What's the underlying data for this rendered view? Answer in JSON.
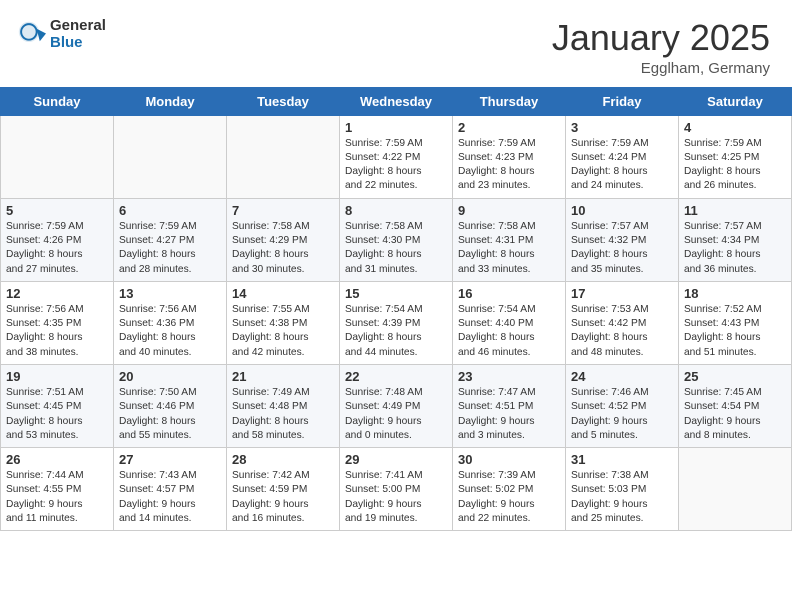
{
  "header": {
    "logo_general": "General",
    "logo_blue": "Blue",
    "month_title": "January 2025",
    "location": "Egglham, Germany"
  },
  "days_of_week": [
    "Sunday",
    "Monday",
    "Tuesday",
    "Wednesday",
    "Thursday",
    "Friday",
    "Saturday"
  ],
  "weeks": [
    [
      {
        "day": "",
        "info": ""
      },
      {
        "day": "",
        "info": ""
      },
      {
        "day": "",
        "info": ""
      },
      {
        "day": "1",
        "info": "Sunrise: 7:59 AM\nSunset: 4:22 PM\nDaylight: 8 hours\nand 22 minutes."
      },
      {
        "day": "2",
        "info": "Sunrise: 7:59 AM\nSunset: 4:23 PM\nDaylight: 8 hours\nand 23 minutes."
      },
      {
        "day": "3",
        "info": "Sunrise: 7:59 AM\nSunset: 4:24 PM\nDaylight: 8 hours\nand 24 minutes."
      },
      {
        "day": "4",
        "info": "Sunrise: 7:59 AM\nSunset: 4:25 PM\nDaylight: 8 hours\nand 26 minutes."
      }
    ],
    [
      {
        "day": "5",
        "info": "Sunrise: 7:59 AM\nSunset: 4:26 PM\nDaylight: 8 hours\nand 27 minutes."
      },
      {
        "day": "6",
        "info": "Sunrise: 7:59 AM\nSunset: 4:27 PM\nDaylight: 8 hours\nand 28 minutes."
      },
      {
        "day": "7",
        "info": "Sunrise: 7:58 AM\nSunset: 4:29 PM\nDaylight: 8 hours\nand 30 minutes."
      },
      {
        "day": "8",
        "info": "Sunrise: 7:58 AM\nSunset: 4:30 PM\nDaylight: 8 hours\nand 31 minutes."
      },
      {
        "day": "9",
        "info": "Sunrise: 7:58 AM\nSunset: 4:31 PM\nDaylight: 8 hours\nand 33 minutes."
      },
      {
        "day": "10",
        "info": "Sunrise: 7:57 AM\nSunset: 4:32 PM\nDaylight: 8 hours\nand 35 minutes."
      },
      {
        "day": "11",
        "info": "Sunrise: 7:57 AM\nSunset: 4:34 PM\nDaylight: 8 hours\nand 36 minutes."
      }
    ],
    [
      {
        "day": "12",
        "info": "Sunrise: 7:56 AM\nSunset: 4:35 PM\nDaylight: 8 hours\nand 38 minutes."
      },
      {
        "day": "13",
        "info": "Sunrise: 7:56 AM\nSunset: 4:36 PM\nDaylight: 8 hours\nand 40 minutes."
      },
      {
        "day": "14",
        "info": "Sunrise: 7:55 AM\nSunset: 4:38 PM\nDaylight: 8 hours\nand 42 minutes."
      },
      {
        "day": "15",
        "info": "Sunrise: 7:54 AM\nSunset: 4:39 PM\nDaylight: 8 hours\nand 44 minutes."
      },
      {
        "day": "16",
        "info": "Sunrise: 7:54 AM\nSunset: 4:40 PM\nDaylight: 8 hours\nand 46 minutes."
      },
      {
        "day": "17",
        "info": "Sunrise: 7:53 AM\nSunset: 4:42 PM\nDaylight: 8 hours\nand 48 minutes."
      },
      {
        "day": "18",
        "info": "Sunrise: 7:52 AM\nSunset: 4:43 PM\nDaylight: 8 hours\nand 51 minutes."
      }
    ],
    [
      {
        "day": "19",
        "info": "Sunrise: 7:51 AM\nSunset: 4:45 PM\nDaylight: 8 hours\nand 53 minutes."
      },
      {
        "day": "20",
        "info": "Sunrise: 7:50 AM\nSunset: 4:46 PM\nDaylight: 8 hours\nand 55 minutes."
      },
      {
        "day": "21",
        "info": "Sunrise: 7:49 AM\nSunset: 4:48 PM\nDaylight: 8 hours\nand 58 minutes."
      },
      {
        "day": "22",
        "info": "Sunrise: 7:48 AM\nSunset: 4:49 PM\nDaylight: 9 hours\nand 0 minutes."
      },
      {
        "day": "23",
        "info": "Sunrise: 7:47 AM\nSunset: 4:51 PM\nDaylight: 9 hours\nand 3 minutes."
      },
      {
        "day": "24",
        "info": "Sunrise: 7:46 AM\nSunset: 4:52 PM\nDaylight: 9 hours\nand 5 minutes."
      },
      {
        "day": "25",
        "info": "Sunrise: 7:45 AM\nSunset: 4:54 PM\nDaylight: 9 hours\nand 8 minutes."
      }
    ],
    [
      {
        "day": "26",
        "info": "Sunrise: 7:44 AM\nSunset: 4:55 PM\nDaylight: 9 hours\nand 11 minutes."
      },
      {
        "day": "27",
        "info": "Sunrise: 7:43 AM\nSunset: 4:57 PM\nDaylight: 9 hours\nand 14 minutes."
      },
      {
        "day": "28",
        "info": "Sunrise: 7:42 AM\nSunset: 4:59 PM\nDaylight: 9 hours\nand 16 minutes."
      },
      {
        "day": "29",
        "info": "Sunrise: 7:41 AM\nSunset: 5:00 PM\nDaylight: 9 hours\nand 19 minutes."
      },
      {
        "day": "30",
        "info": "Sunrise: 7:39 AM\nSunset: 5:02 PM\nDaylight: 9 hours\nand 22 minutes."
      },
      {
        "day": "31",
        "info": "Sunrise: 7:38 AM\nSunset: 5:03 PM\nDaylight: 9 hours\nand 25 minutes."
      },
      {
        "day": "",
        "info": ""
      }
    ]
  ]
}
